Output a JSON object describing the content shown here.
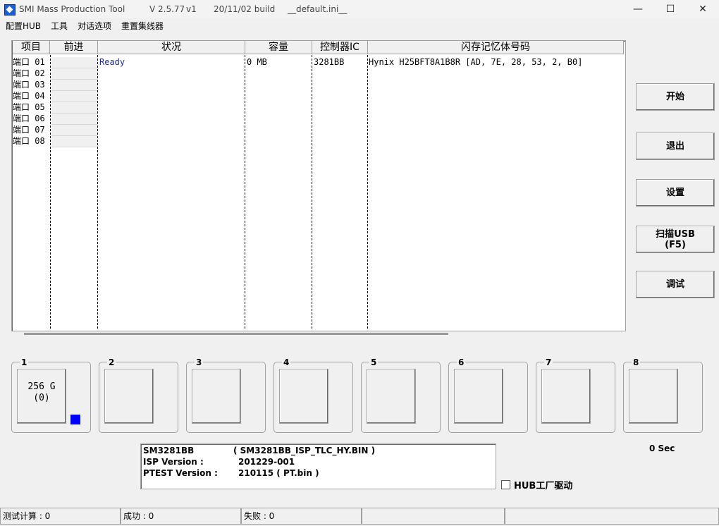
{
  "titlebar": {
    "app_name": "SMI Mass Production Tool",
    "version": "V 2.5.77",
    "variant": "v1",
    "build": "20/11/02 build",
    "config_file": "__default.ini__",
    "minimize": "—",
    "maximize": "☐",
    "close": "✕"
  },
  "menu": [
    "配置HUB",
    "工具",
    "对话选项",
    "重置集线器"
  ],
  "table": {
    "headers": [
      "项目",
      "前进",
      "状况",
      "容量",
      "控制器IC",
      "闪存记忆体号码"
    ],
    "ports": [
      "端口 01",
      "端口 02",
      "端口 03",
      "端口 04",
      "端口 05",
      "端口 06",
      "端口 07",
      "端口 08"
    ],
    "row1": {
      "status": "Ready",
      "capacity": "0 MB",
      "controller": "3281BB",
      "flash": "Hynix H25BFT8A1B8R [AD, 7E, 28, 53, 2, B0]"
    }
  },
  "buttons": {
    "start": "开始",
    "exit": "退出",
    "settings": "设置",
    "scan_line1": "扫描USB",
    "scan_line2": "(F5)",
    "debug": "调试"
  },
  "port_boxes": [
    "1",
    "2",
    "3",
    "4",
    "5",
    "6",
    "7",
    "8"
  ],
  "port1": {
    "capacity": "256 G",
    "count": "(0)",
    "indicator_color": "#0000ff"
  },
  "info": {
    "controller": "SM3281BB",
    "isp_file": "( SM3281BB_ISP_TLC_HY.BIN )",
    "isp_label": "ISP Version :",
    "isp_value": "201229-001",
    "ptest_label": "PTEST Version :",
    "ptest_value": "210115 ( PT.bin )"
  },
  "timer": "0 Sec",
  "hub_driver_label": "HUB工厂驱动",
  "status": {
    "test_count": "测试计算 : 0",
    "success": "成功 : 0",
    "fail": "失败 : 0"
  },
  "colors": {
    "status_text": "#1f2f9f",
    "indicator": "#0000ff"
  }
}
